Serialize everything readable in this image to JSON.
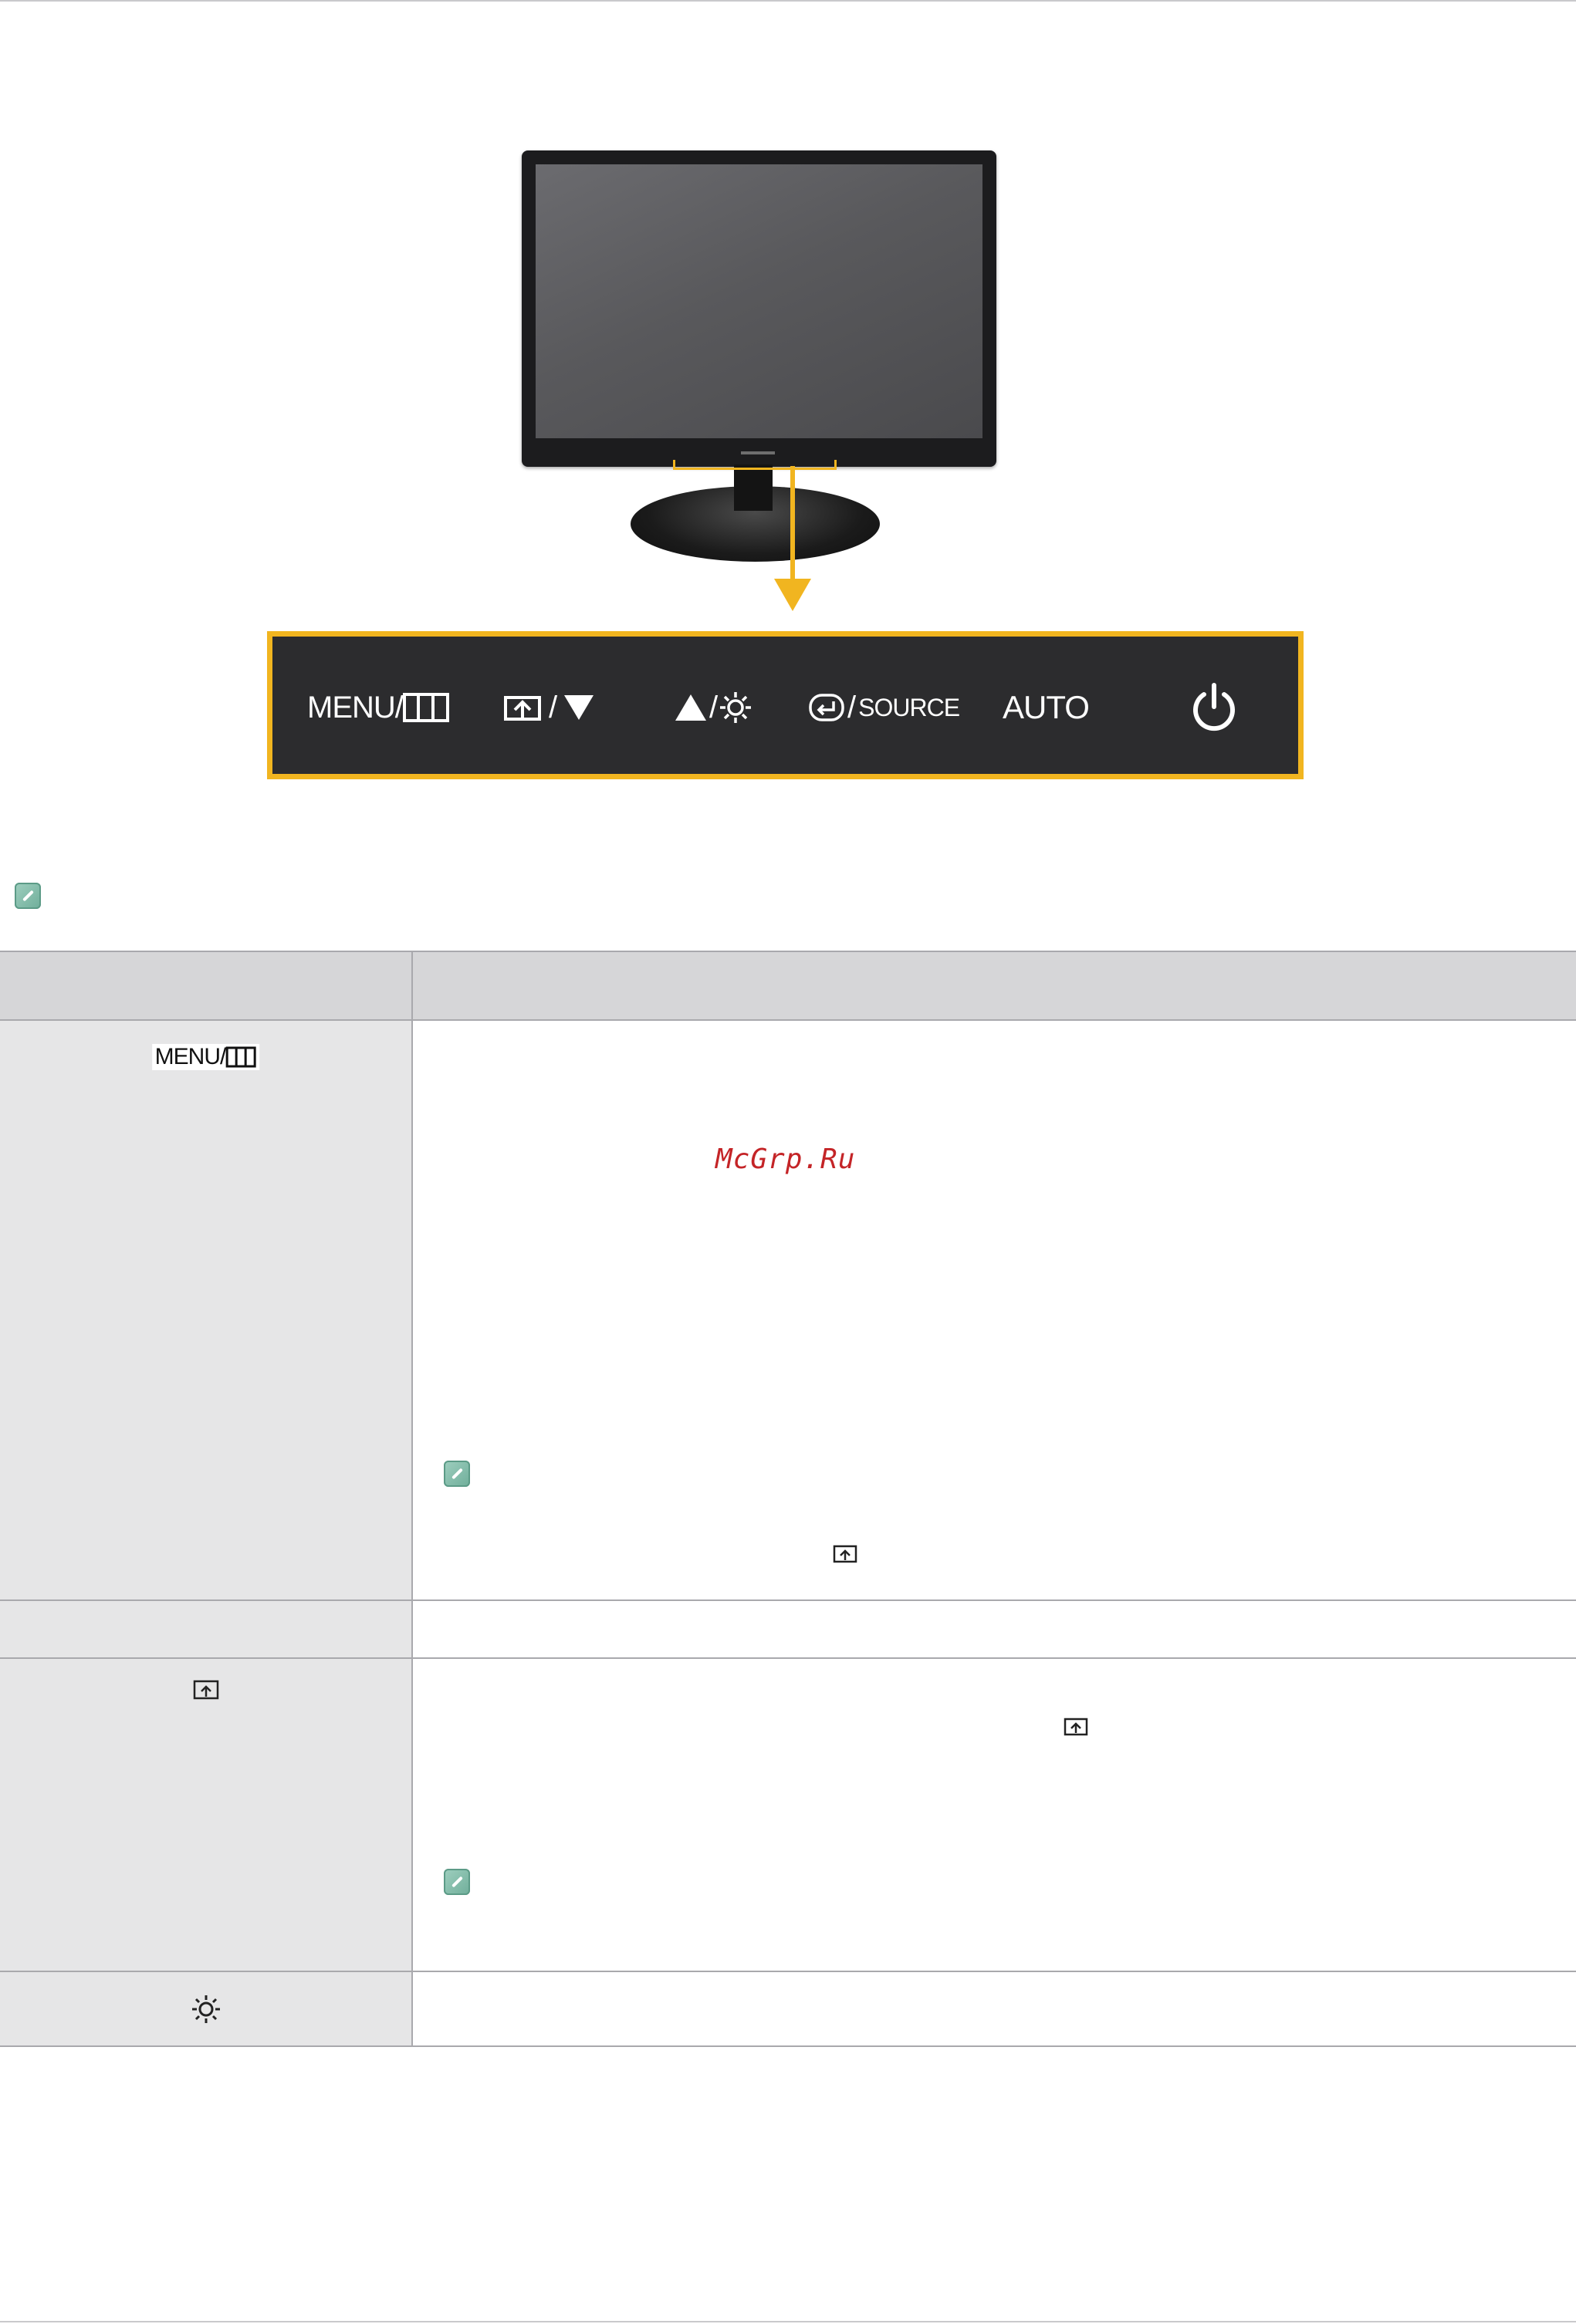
{
  "panel": {
    "menu_label": "MENU/",
    "auto_label": "AUTO",
    "source_label": "SOURCE",
    "slash": "/"
  },
  "table": {
    "rows": [
      {
        "button_label": "MENU/"
      }
    ]
  },
  "watermark": "McGrp.Ru",
  "colors": {
    "accent": "#f1b520",
    "panel_bg": "#2c2c2e",
    "note_green": "#7fb9a5",
    "watermark_red": "#c42427"
  },
  "icons": [
    "note-icon",
    "menu-grid-icon",
    "magicbright-icon",
    "down-triangle-icon",
    "up-triangle-icon",
    "brightness-icon",
    "enter-icon",
    "power-icon"
  ]
}
